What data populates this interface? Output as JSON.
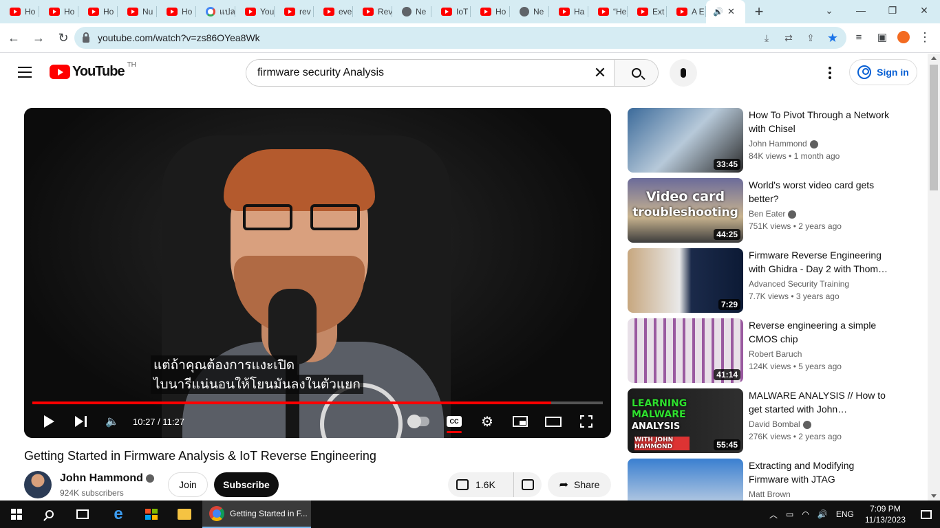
{
  "browser": {
    "tabs": [
      {
        "label": "Ho",
        "icon": "youtube-icon"
      },
      {
        "label": "Ho",
        "icon": "youtube-icon"
      },
      {
        "label": "Ho",
        "icon": "youtube-icon"
      },
      {
        "label": "Nu",
        "icon": "youtube-icon"
      },
      {
        "label": "Ho",
        "icon": "youtube-icon"
      },
      {
        "label": "แปล",
        "icon": "google-icon"
      },
      {
        "label": "You",
        "icon": "youtube-icon"
      },
      {
        "label": "rev",
        "icon": "youtube-icon"
      },
      {
        "label": "eve",
        "icon": "youtube-icon"
      },
      {
        "label": "Rev",
        "icon": "youtube-icon"
      },
      {
        "label": "Ne",
        "icon": "github-icon"
      },
      {
        "label": "IoT",
        "icon": "youtube-icon"
      },
      {
        "label": "Ho",
        "icon": "youtube-icon"
      },
      {
        "label": "Ne",
        "icon": "github-icon"
      },
      {
        "label": "Ha",
        "icon": "youtube-icon"
      },
      {
        "label": "“He",
        "icon": "youtube-icon"
      },
      {
        "label": "Ext",
        "icon": "youtube-icon"
      },
      {
        "label": "A E",
        "icon": "youtube-icon"
      }
    ],
    "url": "youtube.com/watch?v=zs86OYea8Wk"
  },
  "youtube": {
    "logo_text": "YouTube",
    "country_code": "TH",
    "search_value": "firmware security Analysis",
    "signin_label": "Sign in"
  },
  "player": {
    "subtitle_line1": "แต่ถ้าคุณต้องการแงะเปิด",
    "subtitle_line2": "ไบนารีแน่นอนให้โยนมันลงในตัวแยก",
    "time": "10:27 / 11:27",
    "progress": 0.909,
    "buffered": 0.91,
    "cc_label": "CC"
  },
  "video": {
    "title": "Getting Started in Firmware Analysis & IoT Reverse Engineering",
    "channel": "John Hammond",
    "subscribers": "924K subscribers",
    "join_label": "Join",
    "subscribe_label": "Subscribe",
    "likes": "1.6K",
    "share_label": "Share"
  },
  "recommendations": [
    {
      "title": "How To Pivot Through a Network with Chisel",
      "channel": "John Hammond",
      "verified": true,
      "views": "84K views",
      "age": "1 month ago",
      "duration": "33:45"
    },
    {
      "title": "World's worst video card gets better?",
      "channel": "Ben Eater",
      "verified": true,
      "views": "751K views",
      "age": "2 years ago",
      "duration": "44:25",
      "thumb_line1": "Video card",
      "thumb_line2": "troubleshooting"
    },
    {
      "title": "Firmware Reverse Engineering with Ghidra - Day 2 with Thom…",
      "channel": "Advanced Security Training",
      "verified": false,
      "views": "7.7K views",
      "age": "3 years ago",
      "duration": "7:29"
    },
    {
      "title": "Reverse engineering a simple CMOS chip",
      "channel": "Robert Baruch",
      "verified": false,
      "views": "124K views",
      "age": "5 years ago",
      "duration": "41:14"
    },
    {
      "title": "MALWARE ANALYSIS // How to get started with John…",
      "channel": "David Bombal",
      "verified": true,
      "views": "276K views",
      "age": "2 years ago",
      "duration": "55:45",
      "thumb_line1": "LEARNING",
      "thumb_line2": "MALWARE",
      "thumb_line3": "ANALYSIS",
      "thumb_line4": "WITH JOHN HAMMOND"
    },
    {
      "title": "Extracting and Modifying Firmware with JTAG",
      "channel": "Matt Brown",
      "verified": false,
      "views": "",
      "age": "",
      "duration": ""
    }
  ],
  "taskbar": {
    "active_app": "Getting Started in F...",
    "lang": "ENG",
    "time": "7:09 PM",
    "date": "11/13/2023"
  }
}
